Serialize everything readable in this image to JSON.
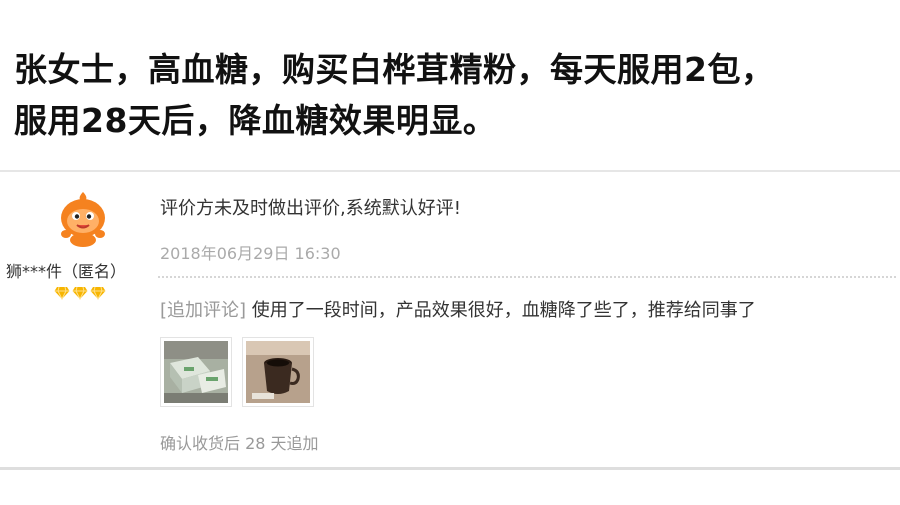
{
  "headline": {
    "line1": "张女士，高血糖，购买白桦茸精粉，每天服用2包，",
    "line2": "服用28天后，降血糖效果明显。"
  },
  "review": {
    "username": "狮***件（匿名）",
    "avatar_icon": "orange-mascot-avatar-icon",
    "vip_badge_icon": "diamond-icon",
    "text": "评价方未及时做出评价,系统默认好评!",
    "date": "2018年06月29日 16:30",
    "followup_tag": "[追加评论]",
    "followup_text": " 使用了一段时间，产品效果很好，血糖降了些了，推荐给同事了",
    "photos": [
      {
        "icon": "product-boxes-photo-icon"
      },
      {
        "icon": "cup-of-drink-photo-icon"
      }
    ],
    "confirm_note": "确认收货后 28 天追加"
  },
  "colors": {
    "headline": "#111111",
    "text": "#333333",
    "muted": "#999999",
    "date": "#aaaaaa",
    "badge": "#f7b500",
    "avatar": "#f5821f"
  }
}
